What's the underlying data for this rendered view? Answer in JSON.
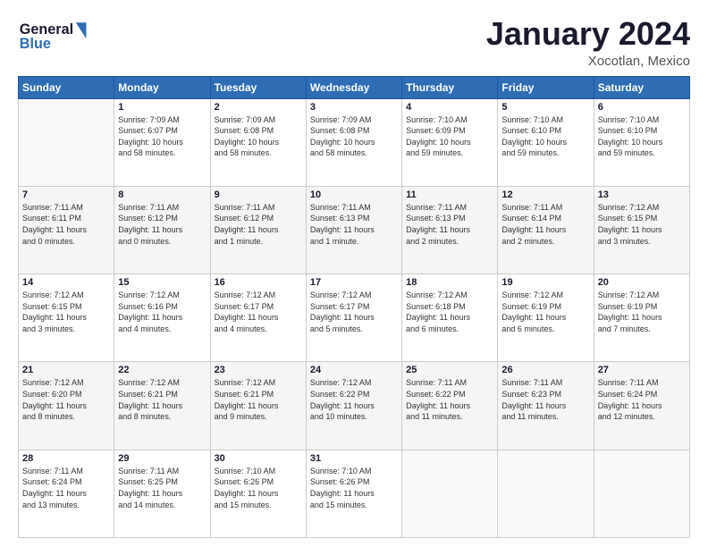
{
  "header": {
    "logo_line1": "General",
    "logo_line2": "Blue",
    "month_title": "January 2024",
    "location": "Xocotlan, Mexico"
  },
  "days_of_week": [
    "Sunday",
    "Monday",
    "Tuesday",
    "Wednesday",
    "Thursday",
    "Friday",
    "Saturday"
  ],
  "weeks": [
    [
      {
        "day": "",
        "info": ""
      },
      {
        "day": "1",
        "info": "Sunrise: 7:09 AM\nSunset: 6:07 PM\nDaylight: 10 hours\nand 58 minutes."
      },
      {
        "day": "2",
        "info": "Sunrise: 7:09 AM\nSunset: 6:08 PM\nDaylight: 10 hours\nand 58 minutes."
      },
      {
        "day": "3",
        "info": "Sunrise: 7:09 AM\nSunset: 6:08 PM\nDaylight: 10 hours\nand 58 minutes."
      },
      {
        "day": "4",
        "info": "Sunrise: 7:10 AM\nSunset: 6:09 PM\nDaylight: 10 hours\nand 59 minutes."
      },
      {
        "day": "5",
        "info": "Sunrise: 7:10 AM\nSunset: 6:10 PM\nDaylight: 10 hours\nand 59 minutes."
      },
      {
        "day": "6",
        "info": "Sunrise: 7:10 AM\nSunset: 6:10 PM\nDaylight: 10 hours\nand 59 minutes."
      }
    ],
    [
      {
        "day": "7",
        "info": "Sunrise: 7:11 AM\nSunset: 6:11 PM\nDaylight: 11 hours\nand 0 minutes."
      },
      {
        "day": "8",
        "info": "Sunrise: 7:11 AM\nSunset: 6:12 PM\nDaylight: 11 hours\nand 0 minutes."
      },
      {
        "day": "9",
        "info": "Sunrise: 7:11 AM\nSunset: 6:12 PM\nDaylight: 11 hours\nand 1 minute."
      },
      {
        "day": "10",
        "info": "Sunrise: 7:11 AM\nSunset: 6:13 PM\nDaylight: 11 hours\nand 1 minute."
      },
      {
        "day": "11",
        "info": "Sunrise: 7:11 AM\nSunset: 6:13 PM\nDaylight: 11 hours\nand 2 minutes."
      },
      {
        "day": "12",
        "info": "Sunrise: 7:11 AM\nSunset: 6:14 PM\nDaylight: 11 hours\nand 2 minutes."
      },
      {
        "day": "13",
        "info": "Sunrise: 7:12 AM\nSunset: 6:15 PM\nDaylight: 11 hours\nand 3 minutes."
      }
    ],
    [
      {
        "day": "14",
        "info": "Sunrise: 7:12 AM\nSunset: 6:15 PM\nDaylight: 11 hours\nand 3 minutes."
      },
      {
        "day": "15",
        "info": "Sunrise: 7:12 AM\nSunset: 6:16 PM\nDaylight: 11 hours\nand 4 minutes."
      },
      {
        "day": "16",
        "info": "Sunrise: 7:12 AM\nSunset: 6:17 PM\nDaylight: 11 hours\nand 4 minutes."
      },
      {
        "day": "17",
        "info": "Sunrise: 7:12 AM\nSunset: 6:17 PM\nDaylight: 11 hours\nand 5 minutes."
      },
      {
        "day": "18",
        "info": "Sunrise: 7:12 AM\nSunset: 6:18 PM\nDaylight: 11 hours\nand 6 minutes."
      },
      {
        "day": "19",
        "info": "Sunrise: 7:12 AM\nSunset: 6:19 PM\nDaylight: 11 hours\nand 6 minutes."
      },
      {
        "day": "20",
        "info": "Sunrise: 7:12 AM\nSunset: 6:19 PM\nDaylight: 11 hours\nand 7 minutes."
      }
    ],
    [
      {
        "day": "21",
        "info": "Sunrise: 7:12 AM\nSunset: 6:20 PM\nDaylight: 11 hours\nand 8 minutes."
      },
      {
        "day": "22",
        "info": "Sunrise: 7:12 AM\nSunset: 6:21 PM\nDaylight: 11 hours\nand 8 minutes."
      },
      {
        "day": "23",
        "info": "Sunrise: 7:12 AM\nSunset: 6:21 PM\nDaylight: 11 hours\nand 9 minutes."
      },
      {
        "day": "24",
        "info": "Sunrise: 7:12 AM\nSunset: 6:22 PM\nDaylight: 11 hours\nand 10 minutes."
      },
      {
        "day": "25",
        "info": "Sunrise: 7:11 AM\nSunset: 6:22 PM\nDaylight: 11 hours\nand 11 minutes."
      },
      {
        "day": "26",
        "info": "Sunrise: 7:11 AM\nSunset: 6:23 PM\nDaylight: 11 hours\nand 11 minutes."
      },
      {
        "day": "27",
        "info": "Sunrise: 7:11 AM\nSunset: 6:24 PM\nDaylight: 11 hours\nand 12 minutes."
      }
    ],
    [
      {
        "day": "28",
        "info": "Sunrise: 7:11 AM\nSunset: 6:24 PM\nDaylight: 11 hours\nand 13 minutes."
      },
      {
        "day": "29",
        "info": "Sunrise: 7:11 AM\nSunset: 6:25 PM\nDaylight: 11 hours\nand 14 minutes."
      },
      {
        "day": "30",
        "info": "Sunrise: 7:10 AM\nSunset: 6:26 PM\nDaylight: 11 hours\nand 15 minutes."
      },
      {
        "day": "31",
        "info": "Sunrise: 7:10 AM\nSunset: 6:26 PM\nDaylight: 11 hours\nand 15 minutes."
      },
      {
        "day": "",
        "info": ""
      },
      {
        "day": "",
        "info": ""
      },
      {
        "day": "",
        "info": ""
      }
    ]
  ]
}
